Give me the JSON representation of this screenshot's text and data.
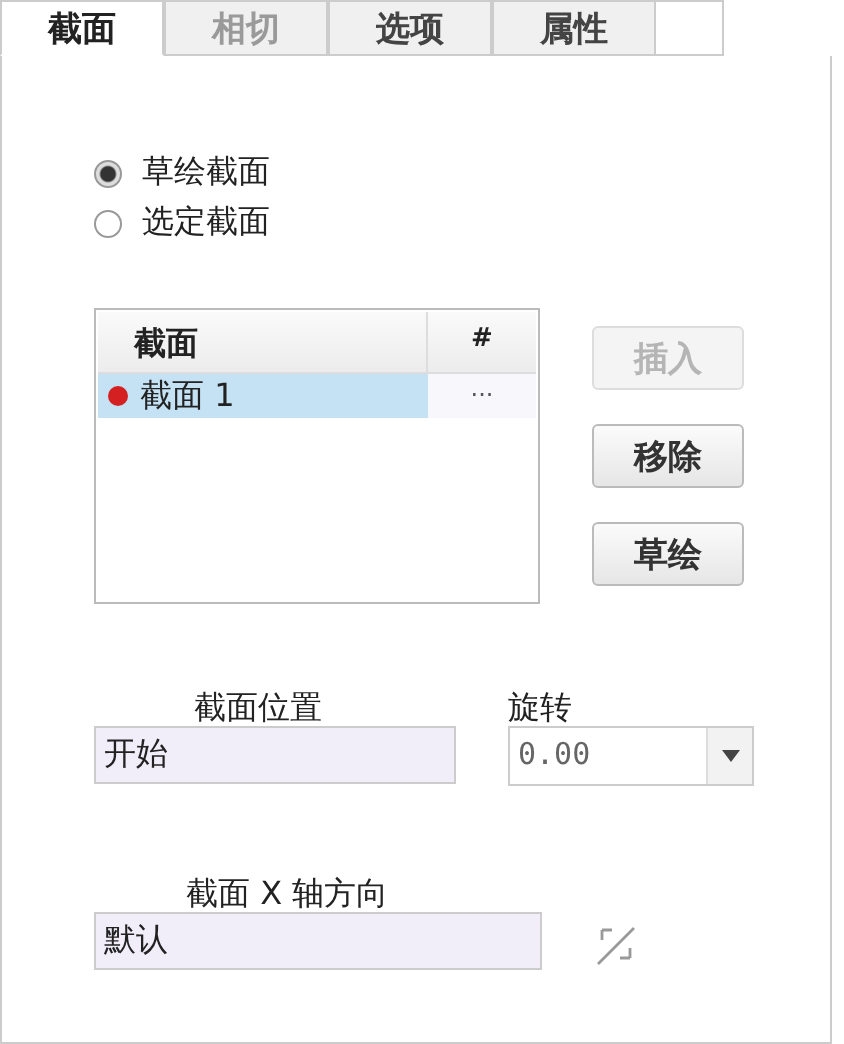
{
  "tabs": [
    {
      "label": "截面",
      "selected": true,
      "disabled": false
    },
    {
      "label": "相切",
      "selected": false,
      "disabled": true
    },
    {
      "label": "选项",
      "selected": false,
      "disabled": false
    },
    {
      "label": "属性",
      "selected": false,
      "disabled": false
    }
  ],
  "radios": [
    {
      "label": "草绘截面",
      "selected": true
    },
    {
      "label": "选定截面",
      "selected": false
    }
  ],
  "section_list": {
    "columns": [
      "截面",
      "#"
    ],
    "rows": [
      {
        "name": "截面 1",
        "value": "...",
        "selected": true,
        "color": "#d42020"
      }
    ]
  },
  "buttons": [
    {
      "label": "插入",
      "disabled": true
    },
    {
      "label": "移除",
      "disabled": false
    },
    {
      "label": "草绘",
      "disabled": false
    }
  ],
  "section_position": {
    "label": "截面位置",
    "value": "开始"
  },
  "rotation": {
    "label": "旋转",
    "value": "0.00"
  },
  "x_axis": {
    "label": "截面 X 轴方向",
    "value": "默认"
  }
}
